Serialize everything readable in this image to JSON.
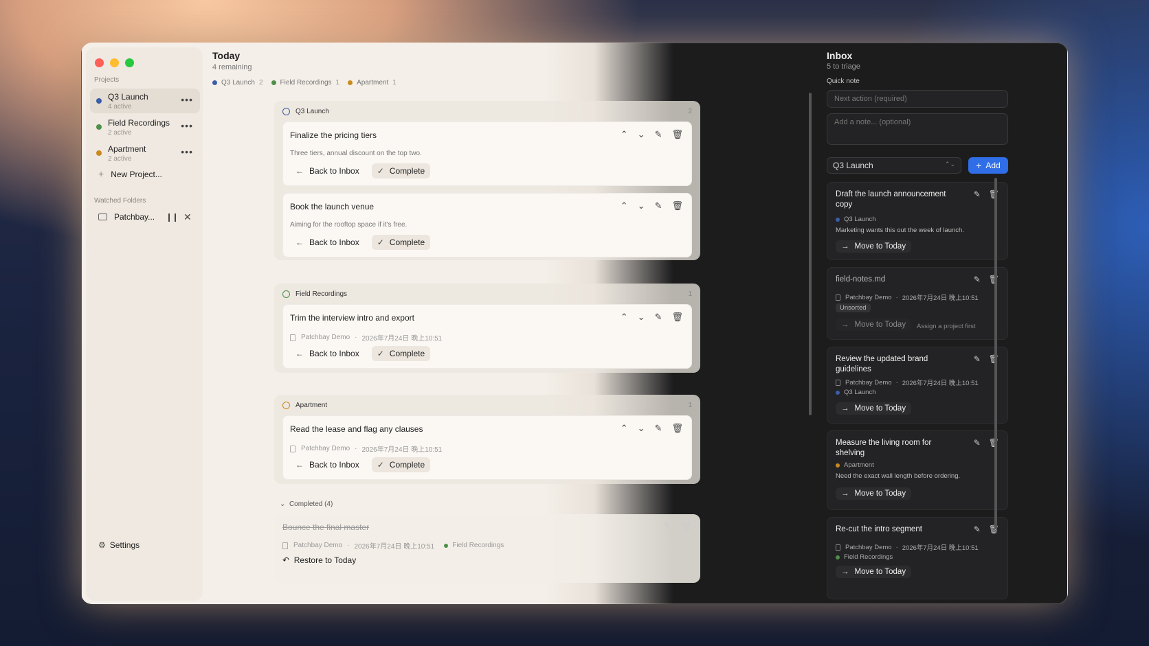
{
  "sidebar": {
    "projects_label": "Projects",
    "projects": [
      {
        "name": "Q3 Launch",
        "sub": "4 active",
        "color": "#3b5ea8"
      },
      {
        "name": "Field Recordings",
        "sub": "2 active",
        "color": "#4f8f4a"
      },
      {
        "name": "Apartment",
        "sub": "2 active",
        "color": "#c98a1f"
      }
    ],
    "more_glyph": "•••",
    "new_project": "New Project...",
    "watched_label": "Watched Folders",
    "folder_name": "Patchbay...",
    "settings": "Settings"
  },
  "main": {
    "title": "Today",
    "subtitle": "4 remaining",
    "chips": [
      {
        "name": "Q3 Launch",
        "count": "2",
        "color": "#3b5ea8"
      },
      {
        "name": "Field Recordings",
        "count": "1",
        "color": "#4f8f4a"
      },
      {
        "name": "Apartment",
        "count": "1",
        "color": "#c98a1f"
      }
    ],
    "groups": [
      {
        "name": "Q3 Launch",
        "count": "2",
        "color": "#3b5ea8"
      },
      {
        "name": "Field Recordings",
        "count": "1",
        "color": "#4f8f4a"
      },
      {
        "name": "Apartment",
        "count": "1",
        "color": "#c98a1f"
      }
    ],
    "cards": [
      {
        "title": "Finalize the pricing tiers",
        "desc": "Three tiers, annual discount on the top two."
      },
      {
        "title": "Book the launch venue",
        "desc": "Aiming for the rooftop space if it's free."
      },
      {
        "title": "Trim the interview intro and export",
        "source": "Patchbay Demo",
        "date": "2026年7月24日 晚上10:51"
      },
      {
        "title": "Read the lease and flag any clauses",
        "source": "Patchbay Demo",
        "date": "2026年7月24日 晚上10:51"
      }
    ],
    "back_label": "Back to Inbox",
    "complete_label": "Complete",
    "completed_label": "Completed (4)",
    "done": {
      "title": "Bounce the final master",
      "source": "Patchbay Demo",
      "date": "2026年7月24日 晚上10:51",
      "project": "Field Recordings",
      "restore": "Restore to Today"
    }
  },
  "inbox": {
    "title": "Inbox",
    "subtitle": "5 to triage",
    "quick_note": "Quick note",
    "action_placeholder": "Next action (required)",
    "note_placeholder": "Add a note... (optional)",
    "project_select": "Q3 Launch",
    "add": "Add",
    "move": "Move to Today",
    "assign_hint": "Assign a project first",
    "unsorted": "Unsorted",
    "items": [
      {
        "title": "Draft the launch announcement copy",
        "project": "Q3 Launch",
        "note": "Marketing wants this out the week of launch."
      },
      {
        "title": "field-notes.md",
        "source": "Patchbay Demo",
        "date": "2026年7月24日 晚上10:51"
      },
      {
        "title": "Review the updated brand guidelines",
        "source": "Patchbay Demo",
        "date": "2026年7月24日 晚上10:51",
        "project": "Q3 Launch"
      },
      {
        "title": "Measure the living room for shelving",
        "project": "Apartment",
        "note": "Need the exact wall length before ordering."
      },
      {
        "title": "Re-cut the intro segment",
        "source": "Patchbay Demo",
        "date": "2026年7月24日 晚上10:51",
        "project": "Field Recordings"
      }
    ]
  }
}
